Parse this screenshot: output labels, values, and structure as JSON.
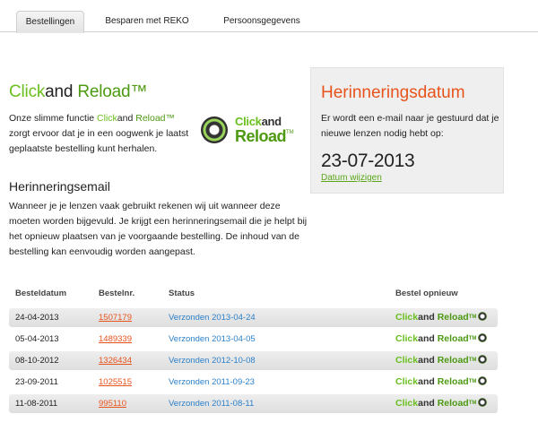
{
  "tabs": [
    {
      "label": "Bestellingen",
      "active": true
    },
    {
      "label": "Besparen met REKO",
      "active": false
    },
    {
      "label": "Persoonsgegevens",
      "active": false
    }
  ],
  "intro": {
    "title_click": "Click",
    "title_and": "and",
    "title_reload": "Reload™",
    "text_before": "Onze slimme functie ",
    "text_click": "Click",
    "text_and": "and",
    "text_reload": " Reload™",
    "text_after": " zorgt ervoor dat je in een oogwenk je laatst geplaatste bestelling kunt herhalen."
  },
  "logo": {
    "word_click": "Click",
    "word_and": "and",
    "word_reload": "Reload",
    "tm": "TM"
  },
  "email_section": {
    "heading": "Herinneringsemail",
    "text": "Wanneer je je lenzen vaak gebruikt rekenen wij uit wanneer deze moeten worden bijgevuld. Je krijgt een herinneringsemail die je helpt bij het opnieuw plaatsen van je voorgaande bestelling. De inhoud van de bestelling kan eenvoudig worden aangepast."
  },
  "reminder": {
    "title": "Herinneringsdatum",
    "text": "Er wordt een e-mail naar je gestuurd dat je nieuwe lenzen nodig hebt op:",
    "date": "23-07-2013",
    "link": "Datum wijzigen"
  },
  "table": {
    "headers": [
      "Besteldatum",
      "Bestelnr.",
      "Status",
      "Bestel opnieuw"
    ],
    "reorder": {
      "click": "Click",
      "and": "and",
      "reload": " Reload",
      "tm": "TM"
    },
    "rows": [
      {
        "date": "24-04-2013",
        "number": "1507179",
        "status": "Verzonden 2013-04-24"
      },
      {
        "date": "05-04-2013",
        "number": "1489339",
        "status": "Verzonden 2013-04-05"
      },
      {
        "date": "08-10-2012",
        "number": "1326434",
        "status": "Verzonden 2012-10-08"
      },
      {
        "date": "23-09-2011",
        "number": "1025515",
        "status": "Verzonden 2011-09-23"
      },
      {
        "date": "11-08-2011",
        "number": "995110",
        "status": "Verzonden 2011-08-11"
      }
    ]
  },
  "colors": {
    "accent_green": "#6abf1e",
    "orange": "#e8531c",
    "link_blue": "#2c80c9"
  }
}
